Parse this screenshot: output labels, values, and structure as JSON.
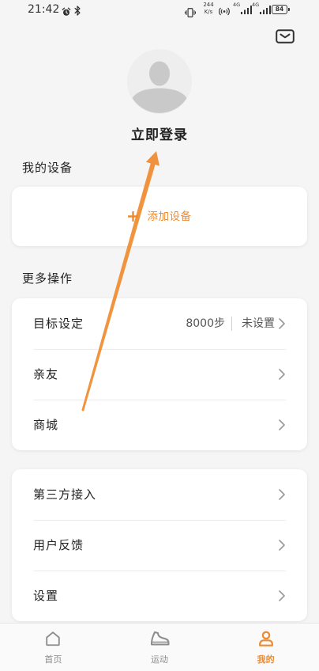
{
  "status_bar": {
    "time": "21:42",
    "net_speed_value": "244",
    "net_speed_unit": "K/s",
    "signal1_label": "4G",
    "signal2_label": "4G",
    "battery": "84",
    "icons": [
      "alarm-icon",
      "bluetooth-icon",
      "vibrate-icon",
      "hotspot-icon",
      "signal-icon",
      "battery-icon"
    ]
  },
  "header": {
    "message_icon": "mail-icon",
    "avatar_icon": "default-avatar-icon"
  },
  "profile": {
    "login_label": "立即登录"
  },
  "devices": {
    "section_title": "我的设备",
    "add_label": "添加设备",
    "add_icon": "plus-icon"
  },
  "more": {
    "section_title": "更多操作",
    "items": [
      {
        "label": "目标设定",
        "value": "8000步",
        "status": "未设置"
      },
      {
        "label": "亲友"
      },
      {
        "label": "商城"
      }
    ]
  },
  "others": {
    "items": [
      {
        "label": "第三方接入"
      },
      {
        "label": "用户反馈"
      },
      {
        "label": "设置"
      }
    ]
  },
  "bottom_nav": {
    "tabs": [
      {
        "label": "首页",
        "icon": "home-icon",
        "active": false
      },
      {
        "label": "运动",
        "icon": "shoe-icon",
        "active": false
      },
      {
        "label": "我的",
        "icon": "user-icon",
        "active": true
      }
    ]
  },
  "colors": {
    "accent": "#ee8a2f",
    "background": "#f5f5f5",
    "card": "#ffffff",
    "text": "#222222",
    "muted": "#8c8c8c",
    "annotation_arrow": "#f0882a"
  }
}
